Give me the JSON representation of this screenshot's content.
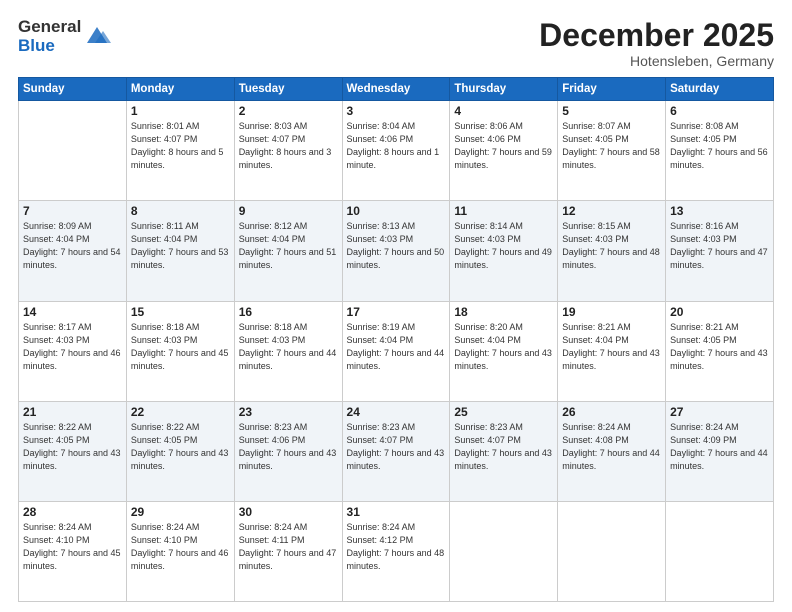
{
  "logo": {
    "general": "General",
    "blue": "Blue"
  },
  "title": {
    "month": "December 2025",
    "location": "Hotensleben, Germany"
  },
  "days": [
    "Sunday",
    "Monday",
    "Tuesday",
    "Wednesday",
    "Thursday",
    "Friday",
    "Saturday"
  ],
  "weeks": [
    [
      {
        "num": "",
        "sunrise": "",
        "sunset": "",
        "daylight": ""
      },
      {
        "num": "1",
        "sunrise": "Sunrise: 8:01 AM",
        "sunset": "Sunset: 4:07 PM",
        "daylight": "Daylight: 8 hours and 5 minutes."
      },
      {
        "num": "2",
        "sunrise": "Sunrise: 8:03 AM",
        "sunset": "Sunset: 4:07 PM",
        "daylight": "Daylight: 8 hours and 3 minutes."
      },
      {
        "num": "3",
        "sunrise": "Sunrise: 8:04 AM",
        "sunset": "Sunset: 4:06 PM",
        "daylight": "Daylight: 8 hours and 1 minute."
      },
      {
        "num": "4",
        "sunrise": "Sunrise: 8:06 AM",
        "sunset": "Sunset: 4:06 PM",
        "daylight": "Daylight: 7 hours and 59 minutes."
      },
      {
        "num": "5",
        "sunrise": "Sunrise: 8:07 AM",
        "sunset": "Sunset: 4:05 PM",
        "daylight": "Daylight: 7 hours and 58 minutes."
      },
      {
        "num": "6",
        "sunrise": "Sunrise: 8:08 AM",
        "sunset": "Sunset: 4:05 PM",
        "daylight": "Daylight: 7 hours and 56 minutes."
      }
    ],
    [
      {
        "num": "7",
        "sunrise": "Sunrise: 8:09 AM",
        "sunset": "Sunset: 4:04 PM",
        "daylight": "Daylight: 7 hours and 54 minutes."
      },
      {
        "num": "8",
        "sunrise": "Sunrise: 8:11 AM",
        "sunset": "Sunset: 4:04 PM",
        "daylight": "Daylight: 7 hours and 53 minutes."
      },
      {
        "num": "9",
        "sunrise": "Sunrise: 8:12 AM",
        "sunset": "Sunset: 4:04 PM",
        "daylight": "Daylight: 7 hours and 51 minutes."
      },
      {
        "num": "10",
        "sunrise": "Sunrise: 8:13 AM",
        "sunset": "Sunset: 4:03 PM",
        "daylight": "Daylight: 7 hours and 50 minutes."
      },
      {
        "num": "11",
        "sunrise": "Sunrise: 8:14 AM",
        "sunset": "Sunset: 4:03 PM",
        "daylight": "Daylight: 7 hours and 49 minutes."
      },
      {
        "num": "12",
        "sunrise": "Sunrise: 8:15 AM",
        "sunset": "Sunset: 4:03 PM",
        "daylight": "Daylight: 7 hours and 48 minutes."
      },
      {
        "num": "13",
        "sunrise": "Sunrise: 8:16 AM",
        "sunset": "Sunset: 4:03 PM",
        "daylight": "Daylight: 7 hours and 47 minutes."
      }
    ],
    [
      {
        "num": "14",
        "sunrise": "Sunrise: 8:17 AM",
        "sunset": "Sunset: 4:03 PM",
        "daylight": "Daylight: 7 hours and 46 minutes."
      },
      {
        "num": "15",
        "sunrise": "Sunrise: 8:18 AM",
        "sunset": "Sunset: 4:03 PM",
        "daylight": "Daylight: 7 hours and 45 minutes."
      },
      {
        "num": "16",
        "sunrise": "Sunrise: 8:18 AM",
        "sunset": "Sunset: 4:03 PM",
        "daylight": "Daylight: 7 hours and 44 minutes."
      },
      {
        "num": "17",
        "sunrise": "Sunrise: 8:19 AM",
        "sunset": "Sunset: 4:04 PM",
        "daylight": "Daylight: 7 hours and 44 minutes."
      },
      {
        "num": "18",
        "sunrise": "Sunrise: 8:20 AM",
        "sunset": "Sunset: 4:04 PM",
        "daylight": "Daylight: 7 hours and 43 minutes."
      },
      {
        "num": "19",
        "sunrise": "Sunrise: 8:21 AM",
        "sunset": "Sunset: 4:04 PM",
        "daylight": "Daylight: 7 hours and 43 minutes."
      },
      {
        "num": "20",
        "sunrise": "Sunrise: 8:21 AM",
        "sunset": "Sunset: 4:05 PM",
        "daylight": "Daylight: 7 hours and 43 minutes."
      }
    ],
    [
      {
        "num": "21",
        "sunrise": "Sunrise: 8:22 AM",
        "sunset": "Sunset: 4:05 PM",
        "daylight": "Daylight: 7 hours and 43 minutes."
      },
      {
        "num": "22",
        "sunrise": "Sunrise: 8:22 AM",
        "sunset": "Sunset: 4:05 PM",
        "daylight": "Daylight: 7 hours and 43 minutes."
      },
      {
        "num": "23",
        "sunrise": "Sunrise: 8:23 AM",
        "sunset": "Sunset: 4:06 PM",
        "daylight": "Daylight: 7 hours and 43 minutes."
      },
      {
        "num": "24",
        "sunrise": "Sunrise: 8:23 AM",
        "sunset": "Sunset: 4:07 PM",
        "daylight": "Daylight: 7 hours and 43 minutes."
      },
      {
        "num": "25",
        "sunrise": "Sunrise: 8:23 AM",
        "sunset": "Sunset: 4:07 PM",
        "daylight": "Daylight: 7 hours and 43 minutes."
      },
      {
        "num": "26",
        "sunrise": "Sunrise: 8:24 AM",
        "sunset": "Sunset: 4:08 PM",
        "daylight": "Daylight: 7 hours and 44 minutes."
      },
      {
        "num": "27",
        "sunrise": "Sunrise: 8:24 AM",
        "sunset": "Sunset: 4:09 PM",
        "daylight": "Daylight: 7 hours and 44 minutes."
      }
    ],
    [
      {
        "num": "28",
        "sunrise": "Sunrise: 8:24 AM",
        "sunset": "Sunset: 4:10 PM",
        "daylight": "Daylight: 7 hours and 45 minutes."
      },
      {
        "num": "29",
        "sunrise": "Sunrise: 8:24 AM",
        "sunset": "Sunset: 4:10 PM",
        "daylight": "Daylight: 7 hours and 46 minutes."
      },
      {
        "num": "30",
        "sunrise": "Sunrise: 8:24 AM",
        "sunset": "Sunset: 4:11 PM",
        "daylight": "Daylight: 7 hours and 47 minutes."
      },
      {
        "num": "31",
        "sunrise": "Sunrise: 8:24 AM",
        "sunset": "Sunset: 4:12 PM",
        "daylight": "Daylight: 7 hours and 48 minutes."
      },
      {
        "num": "",
        "sunrise": "",
        "sunset": "",
        "daylight": ""
      },
      {
        "num": "",
        "sunrise": "",
        "sunset": "",
        "daylight": ""
      },
      {
        "num": "",
        "sunrise": "",
        "sunset": "",
        "daylight": ""
      }
    ]
  ]
}
